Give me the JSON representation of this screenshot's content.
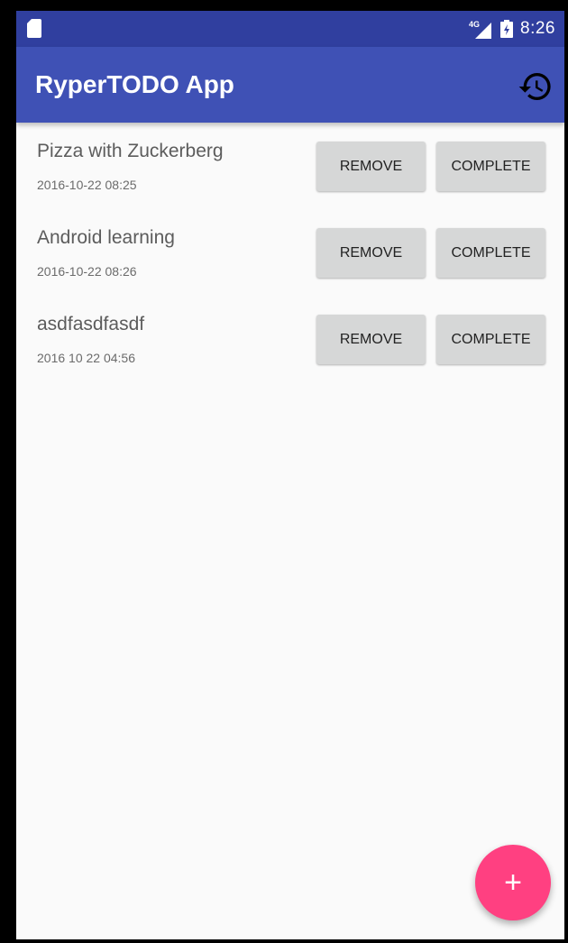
{
  "status_bar": {
    "network_label": "4G",
    "time": "8:26",
    "left_icon": "sd-card-icon",
    "battery_icon": "battery-icon",
    "signal_icon": "signal-icon"
  },
  "app_bar": {
    "title": "RyperTODO App",
    "action_icon": "history-icon"
  },
  "todos": [
    {
      "title": "Pizza with Zuckerberg",
      "date": "2016-10-22 08:25",
      "remove_label": "REMOVE",
      "complete_label": "COMPLETE"
    },
    {
      "title": "Android learning",
      "date": "2016-10-22 08:26",
      "remove_label": "REMOVE",
      "complete_label": "COMPLETE"
    },
    {
      "title": "asdfasdfasdf",
      "date": "2016 10 22 04:56",
      "remove_label": "REMOVE",
      "complete_label": "COMPLETE"
    }
  ],
  "fab": {
    "label": "+",
    "icon": "plus-icon"
  },
  "colors": {
    "status_bar": "#303f9f",
    "app_bar": "#3f51b5",
    "fab": "#ff4081",
    "button": "#d6d7d7",
    "background": "#fafafa"
  }
}
